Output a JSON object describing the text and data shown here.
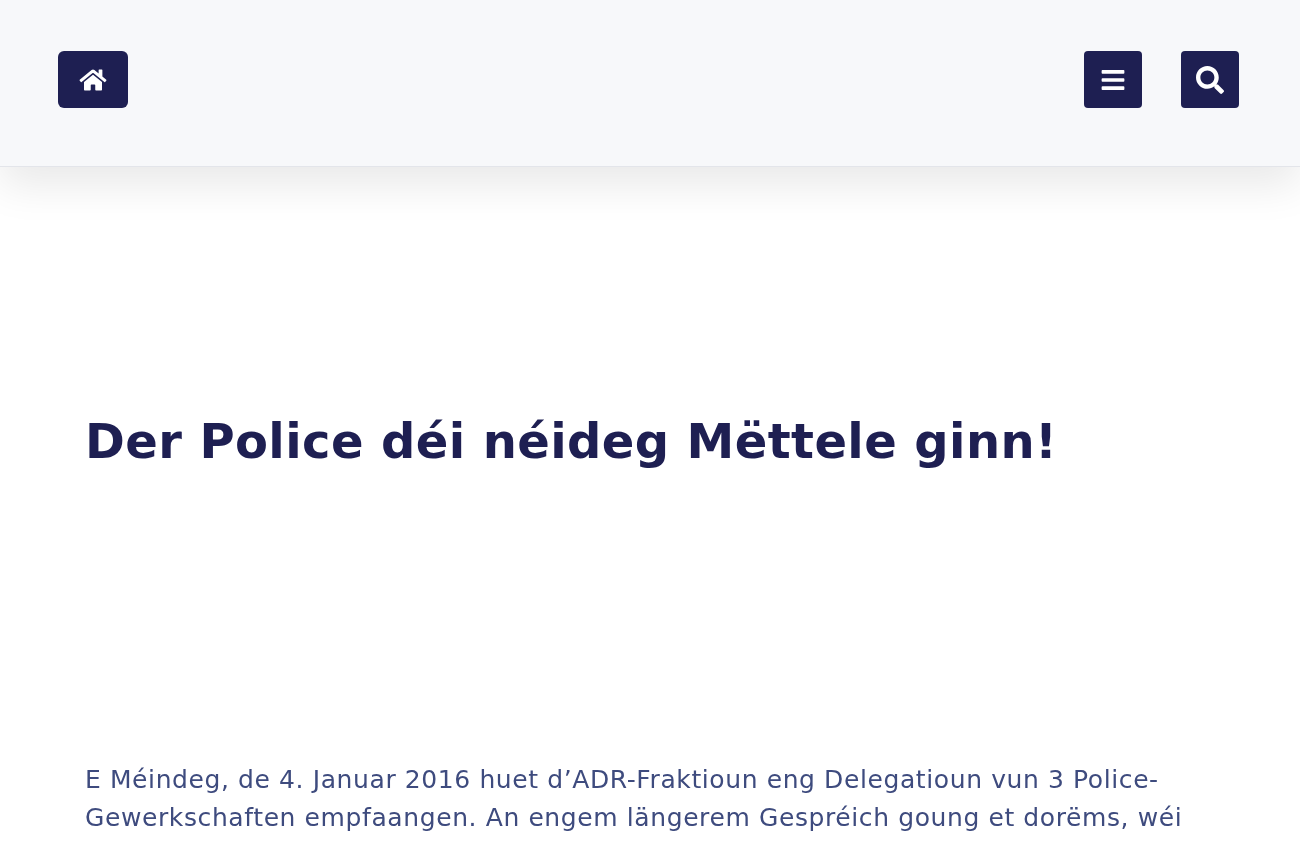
{
  "article": {
    "title": "Der Police déi néideg Mëttele ginn!",
    "paragraph": "E Méindeg, de 4. Januar 2016 huet d’ADR-Fraktioun eng Delegatioun vun 3 Police-Gewerkschaften empfaangen. An engem längerem Gespréich goung et dorëms, wéi"
  }
}
